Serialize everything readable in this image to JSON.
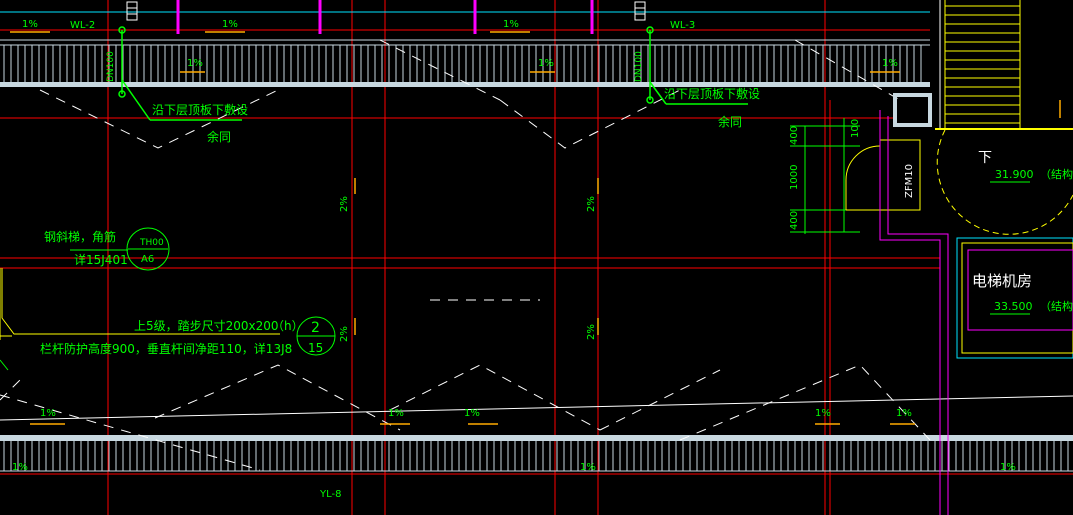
{
  "slopes": {
    "s1": "1%",
    "s2": "1%",
    "s3": "1%",
    "s4": "1%",
    "s5": "1%",
    "s6": "1%",
    "s7": "1%",
    "s8": "1%",
    "s9": "1%",
    "s10": "1%",
    "s11": "1%",
    "s12": "1%",
    "s13": "1%",
    "s14": "1%",
    "v1": "2%",
    "v2": "2%",
    "v3": "2%",
    "v4": "2%"
  },
  "pipes": {
    "wl2": "WL-2",
    "wl3": "WL-3",
    "yl8": "YL-8",
    "pipe_note_left": "DN100",
    "pipe_note_right": "DN100"
  },
  "notes": {
    "along_slab_left": "沿下层顶板下敷设",
    "same_left": "余同",
    "along_slab_right": "沿下层顶板下敷设",
    "same_right": "余同",
    "steel_ladder": "钢斜梯，角筋",
    "steel_ladder_ref": "详15J401",
    "detail_top": "TH00",
    "detail_bottom": "A6",
    "stairs_line": "上5级，踏步尺寸200x200",
    "stairs_h": "（h）",
    "railing_line": "栏杆防护高度900，垂直杆间净距110，详13J8",
    "detail2_top": "2",
    "detail2_bottom": "15"
  },
  "dims": {
    "d400a": "400",
    "d1000": "1000",
    "d400b": "400",
    "d100": "100",
    "door": "ZFM10"
  },
  "rooms": {
    "down": "下",
    "elev_top": "31.900",
    "elev_top_note": "（结构",
    "machine_room": "电梯机房",
    "elev_machine": "33.500",
    "elev_machine_note": "（结构"
  },
  "colors": {
    "background": "#000000",
    "axis": "#ff0000",
    "text": "#00ff00",
    "dash": "#ffffff",
    "parapet": "#c8d8e0",
    "pipe": "#ff00ff",
    "outline": "#ffff00"
  }
}
